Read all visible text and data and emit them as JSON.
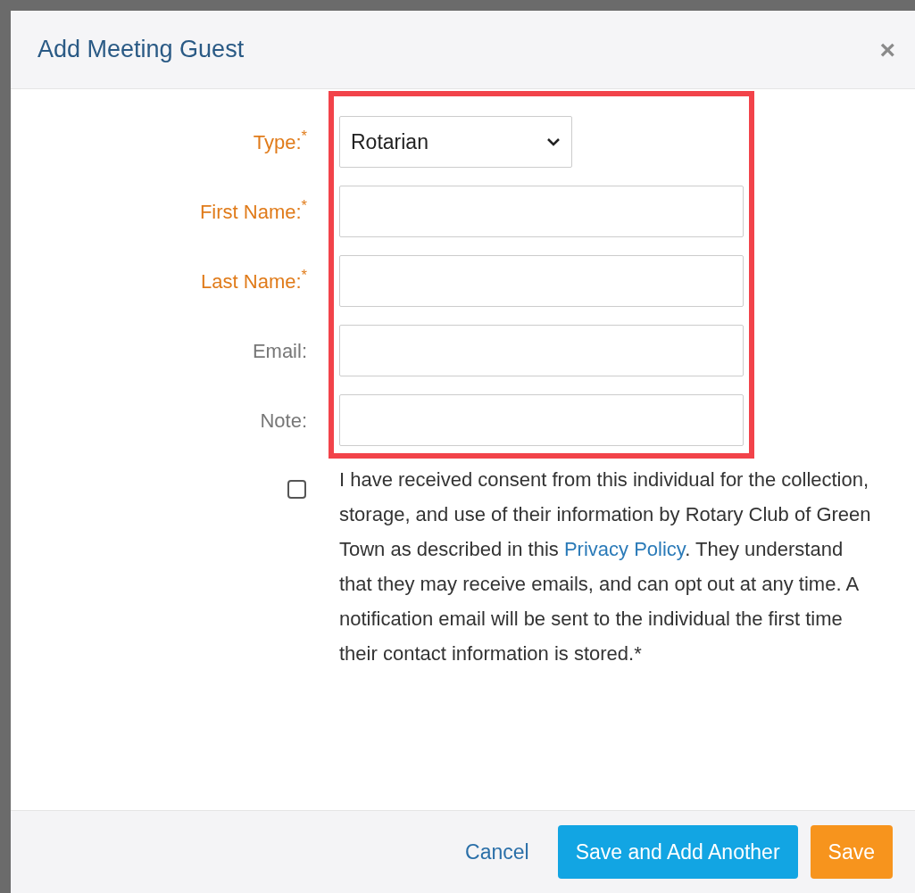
{
  "dialog": {
    "title": "Add Meeting Guest",
    "close": "×"
  },
  "fields": [
    {
      "kind": "select",
      "label": "Type:$^{*}$",
      "required": true,
      "value": "Rotarian"
    },
    {
      "kind": "text",
      "label": "First Name:$^{*}$",
      "required": true
    },
    {
      "kind": "text",
      "label": "Last Name:$^{*}$",
      "required": true
    },
    {
      "kind": "text",
      "label": "Email:",
      "required": false
    },
    {
      "kind": "text",
      "label": "Note:",
      "required": false
    }
  ],
  "consent": {
    "checked": false,
    "text_before": "I have received consent from this individual for the collection, storage, and use of their information by Rotary Club of Green Town as described in this ",
    "link": "Privacy Policy",
    "text_after": ". They understand that they may receive emails, and can opt out at any time. A notification email will be sent to the individual the first time their contact information is stored.*"
  },
  "footer": {
    "cancel": "Cancel",
    "buttons": [
      {
        "kind": "primary",
        "label": "Save and Add Another"
      },
      {
        "kind": "warning",
        "label": "Save"
      }
    ]
  }
}
